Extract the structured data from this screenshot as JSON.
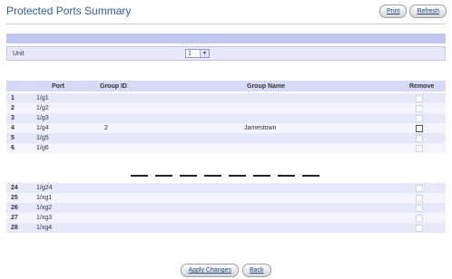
{
  "page": {
    "title": "Protected Ports Summary"
  },
  "toolbar": {
    "print_label": "Print",
    "refresh_label": "Refresh"
  },
  "unit": {
    "label": "Unit",
    "value": "1"
  },
  "table": {
    "headers": {
      "port": "Port",
      "group_id": "Group ID",
      "group_name": "Group Name",
      "remove": "Remove"
    },
    "rows_top": [
      {
        "idx": "1",
        "port": "1/g1",
        "group_id": "",
        "group_name": ""
      },
      {
        "idx": "2",
        "port": "1/g2",
        "group_id": "",
        "group_name": ""
      },
      {
        "idx": "3",
        "port": "1/g3",
        "group_id": "",
        "group_name": ""
      },
      {
        "idx": "4",
        "port": "1/g4",
        "group_id": "2",
        "group_name": "Jamestown"
      },
      {
        "idx": "5",
        "port": "1/g5",
        "group_id": "",
        "group_name": ""
      },
      {
        "idx": "6",
        "port": "1/g6",
        "group_id": "",
        "group_name": ""
      }
    ],
    "rows_bottom": [
      {
        "idx": "24",
        "port": "1/g24",
        "group_id": "",
        "group_name": ""
      },
      {
        "idx": "25",
        "port": "1/xg1",
        "group_id": "",
        "group_name": ""
      },
      {
        "idx": "26",
        "port": "1/xg2",
        "group_id": "",
        "group_name": ""
      },
      {
        "idx": "27",
        "port": "1/xg3",
        "group_id": "",
        "group_name": ""
      },
      {
        "idx": "28",
        "port": "1/xg4",
        "group_id": "",
        "group_name": ""
      }
    ]
  },
  "footer": {
    "apply_label": "Apply Changes",
    "back_label": "Back"
  }
}
